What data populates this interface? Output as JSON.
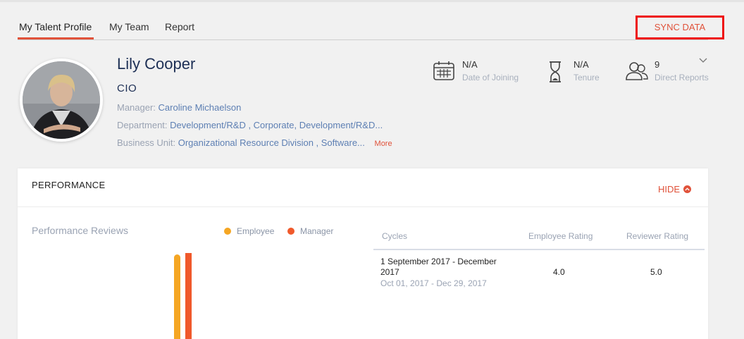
{
  "tabs": [
    {
      "label": "My Talent Profile",
      "active": true
    },
    {
      "label": "My Team",
      "active": false
    },
    {
      "label": "Report",
      "active": false
    }
  ],
  "sync_label": "SYNC DATA",
  "profile": {
    "name": "Lily Cooper",
    "role": "CIO",
    "manager_label": "Manager:",
    "manager": "Caroline Michaelson",
    "department_label": "Department:",
    "department": "Development/R&D , Corporate, Development/R&D...",
    "business_unit_label": "Business Unit:",
    "business_unit": "Organizational Resource Division , Software...",
    "more_label": "More"
  },
  "stats": [
    {
      "icon": "calendar-icon",
      "value": "N/A",
      "label": "Date of Joining"
    },
    {
      "icon": "hourglass-icon",
      "value": "N/A",
      "label": "Tenure"
    },
    {
      "icon": "people-icon",
      "value": "9",
      "label": "Direct Reports"
    }
  ],
  "performance": {
    "section_title": "PERFORMANCE",
    "hide_label": "HIDE",
    "reviews_title": "Performance Reviews",
    "legend": [
      {
        "label": "Employee",
        "color": "#f5a623"
      },
      {
        "label": "Manager",
        "color": "#f0592b"
      }
    ],
    "table": {
      "headers": [
        "Cycles",
        "Employee Rating",
        "Reviewer Rating"
      ],
      "rows": [
        {
          "cycle": "1 September 2017 - December 2017",
          "dates": "Oct 01, 2017 - Dec 29, 2017",
          "employee_rating": "4.0",
          "reviewer_rating": "5.0"
        }
      ]
    }
  },
  "chart_data": {
    "type": "bar",
    "categories": [
      ""
    ],
    "series": [
      {
        "name": "Employee",
        "values": [
          4.0
        ]
      },
      {
        "name": "Manager",
        "values": [
          5.0
        ]
      }
    ],
    "ylim": [
      0,
      5
    ]
  },
  "colors": {
    "accent": "#e0523a",
    "employee": "#f5a623",
    "manager": "#f0592b"
  }
}
